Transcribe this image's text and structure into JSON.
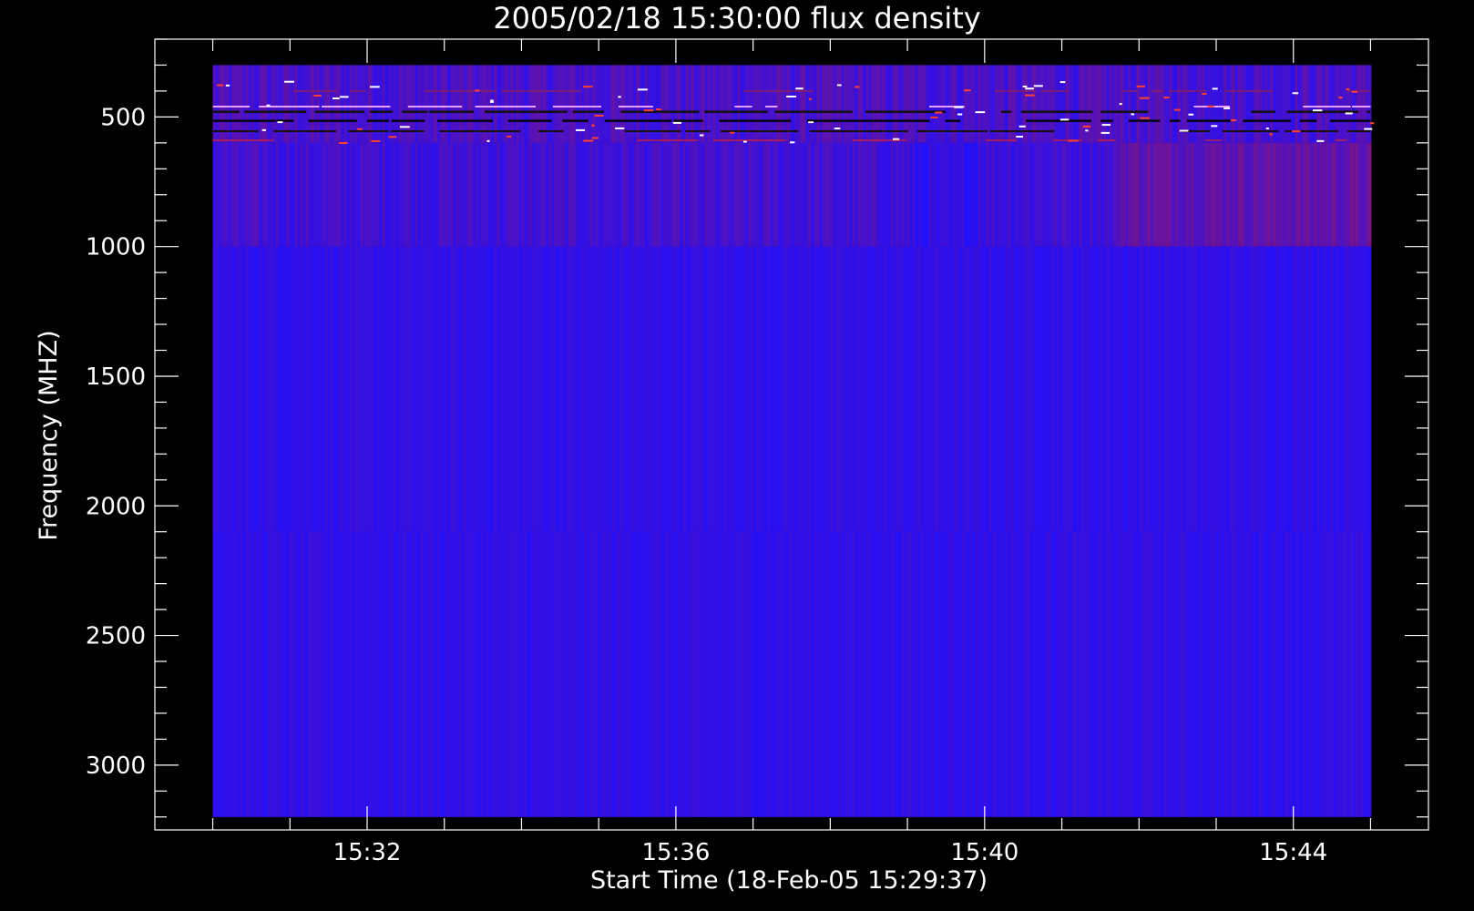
{
  "chart_data": {
    "type": "heatmap",
    "title": "2005/02/18 15:30:00 flux density",
    "xlabel": "Start Time (18-Feb-05 15:29:37)",
    "ylabel": "Frequency (MHZ)",
    "x_axis": {
      "unit": "time",
      "data_range": [
        "15:30:00",
        "15:45:00"
      ],
      "axis_range": [
        "15:29:15",
        "15:45:45"
      ],
      "major_ticks": [
        "15:32",
        "15:36",
        "15:40",
        "15:44"
      ],
      "minor_tick_step_minutes": 1
    },
    "y_axis": {
      "unit": "MHz",
      "inverted": true,
      "data_range": [
        300,
        3200
      ],
      "axis_range": [
        200,
        3250
      ],
      "major_ticks": [
        500,
        1000,
        1500,
        2000,
        2500,
        3000
      ],
      "minor_tick_step": 100
    },
    "bands": [
      {
        "freq_range": [
          300,
          600
        ],
        "level": "active",
        "note": "horizontal emission lines"
      },
      {
        "freq_range": [
          600,
          1000
        ],
        "level": "elevated"
      },
      {
        "freq_range": [
          1000,
          2100
        ],
        "level": "background"
      },
      {
        "freq_range": [
          2100,
          3200
        ],
        "level": "background"
      }
    ],
    "colors": {
      "background": "#000000",
      "axis": "#ffffff",
      "low": "#1f10ff",
      "high": "#c01830"
    },
    "grid": false,
    "legend": "none"
  }
}
